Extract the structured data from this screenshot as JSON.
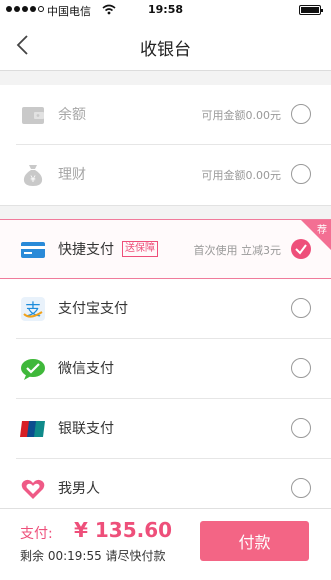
{
  "status_bar": {
    "carrier": "中国电信",
    "time": "19:58"
  },
  "header": {
    "title": "收银台"
  },
  "balance_rows": [
    {
      "label": "余额",
      "note": "可用金额0.00元",
      "icon": "wallet-icon"
    },
    {
      "label": "理财",
      "note": "可用金额0.00元",
      "icon": "money-bag-icon"
    }
  ],
  "quick_pay": {
    "label": "快捷支付",
    "tag": "送保障",
    "note": "首次使用 立减3元",
    "corner": "荐",
    "icon": "card-icon"
  },
  "methods": [
    {
      "label": "支付宝支付",
      "icon": "alipay-icon"
    },
    {
      "label": "微信支付",
      "icon": "wechat-icon"
    },
    {
      "label": "银联支付",
      "icon": "unionpay-icon"
    },
    {
      "label": "我男人",
      "icon": "heart-icon"
    }
  ],
  "footer": {
    "pay_label": "支付:",
    "amount": "¥ 135.60",
    "countdown": "剩余 00:19:55 请尽快付款",
    "pay_button": "付款"
  },
  "colors": {
    "accent": "#ee4f7a",
    "button": "#f36585"
  }
}
